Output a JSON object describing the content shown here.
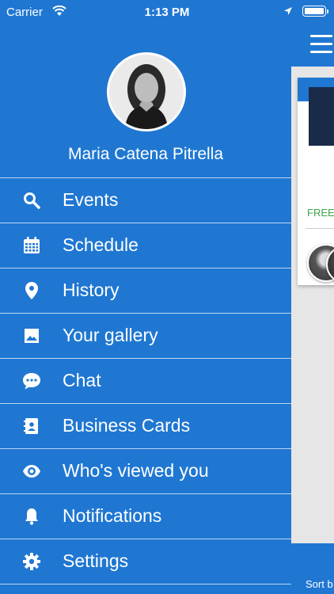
{
  "status_bar": {
    "carrier": "Carrier",
    "time": "1:13 PM"
  },
  "profile": {
    "name": "Maria Catena Pitrella"
  },
  "menu": {
    "items": [
      {
        "label": "Events",
        "icon": "search-icon"
      },
      {
        "label": "Schedule",
        "icon": "calendar-icon"
      },
      {
        "label": "History",
        "icon": "location-pin-icon"
      },
      {
        "label": "Your gallery",
        "icon": "image-icon"
      },
      {
        "label": "Chat",
        "icon": "chat-bubble-icon"
      },
      {
        "label": "Business Cards",
        "icon": "contact-book-icon"
      },
      {
        "label": "Who's viewed you",
        "icon": "eye-icon"
      },
      {
        "label": "Notifications",
        "icon": "bell-icon"
      },
      {
        "label": "Settings",
        "icon": "gear-icon"
      }
    ]
  },
  "background_app": {
    "badge_text": "FREE",
    "footer_text": "Sort b"
  },
  "colors": {
    "primary": "#1f77d2",
    "free_green": "#3fa34d"
  }
}
